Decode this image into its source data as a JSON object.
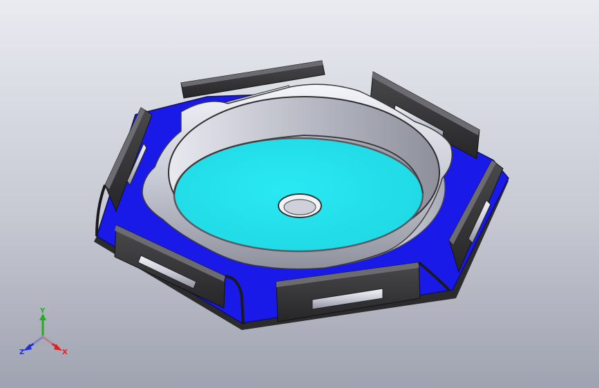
{
  "viewport": {
    "background_top": "#e9ebf1",
    "background_bottom": "#9fa3b0"
  },
  "model": {
    "base_plate_color": "#1a1ae8",
    "dish_floor_color": "#22e4ee",
    "metal_color": "#c9cbd6",
    "wall_color": "#3a3a3a"
  },
  "triad": {
    "x_label": "X",
    "y_label": "Y",
    "z_label": "Z",
    "x_color": "#e02020",
    "y_color": "#20b020",
    "z_color": "#2030d0"
  }
}
